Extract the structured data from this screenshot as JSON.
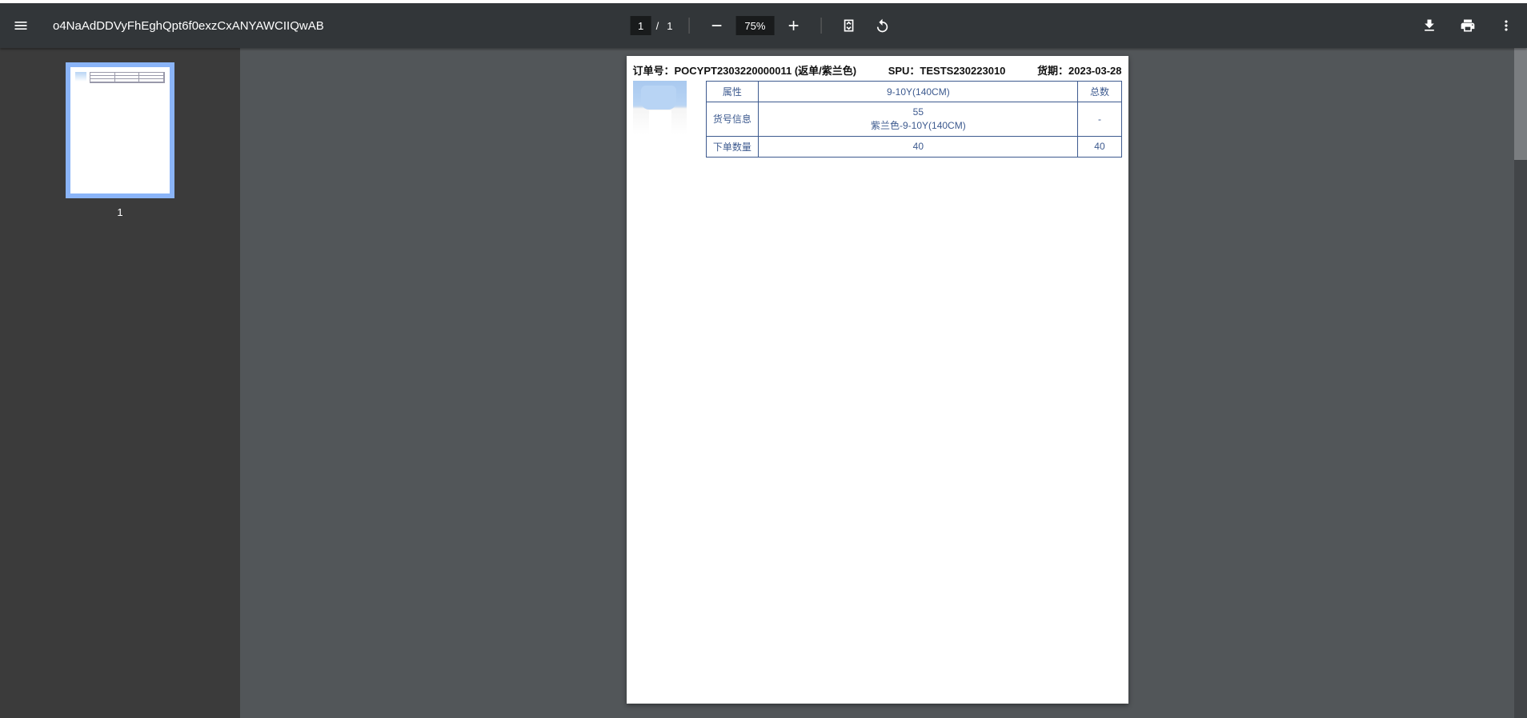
{
  "toolbar": {
    "filename": "o4NaAdDDVyFhEghQpt6f0exzCxANYAWCIIQwAB",
    "page_current": "1",
    "page_total": "1",
    "zoom": "75%"
  },
  "sidebar": {
    "thumb_label": "1"
  },
  "document": {
    "header": {
      "order_full": "订单号：POCYPT2303220000011 (返单/紫兰色)",
      "spu_full": "SPU：TESTS230223010",
      "date_full": "货期：2023-03-28"
    },
    "table": {
      "row1_label": "属性",
      "row1_value": "9-10Y(140CM)",
      "row1_total": "总数",
      "row2_label": "货号信息",
      "row2_line1": "55",
      "row2_line2": "紫兰色-9-10Y(140CM)",
      "row2_total": "-",
      "row3_label": "下单数量",
      "row3_value": "40",
      "row3_total": "40"
    }
  }
}
